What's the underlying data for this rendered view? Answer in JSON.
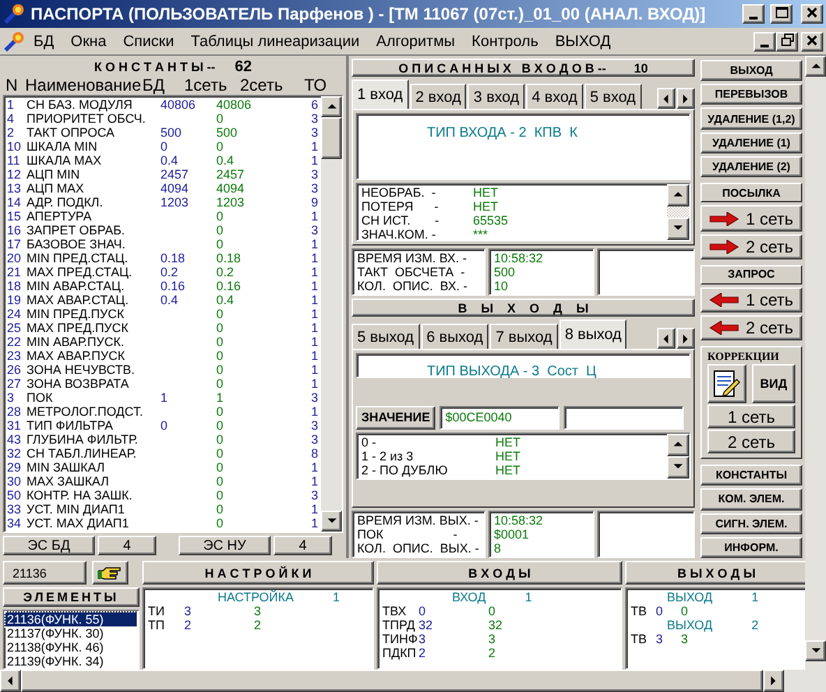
{
  "window": {
    "title": "ПАСПОРТА  (ПОЛЬЗОВАТЕЛЬ Парфенов ) - [ТМ 11067 (07ст.)_01_00 (АНАЛ. ВХОД)]"
  },
  "menu": [
    "БД",
    "Окна",
    "Списки",
    "Таблицы линеаризации",
    "Алгоритмы",
    "Контроль",
    "ВЫХОД"
  ],
  "constants": {
    "title": "К О Н С Т А Н Т Ы --",
    "count": "62",
    "columns": [
      "N",
      "Наименование",
      "БД",
      "1сеть",
      "2сеть",
      "ТО"
    ],
    "rows": [
      {
        "n": "1",
        "name": "СН БАЗ. МОДУЛЯ",
        "bd": "40806",
        "net1": "40806",
        "to": "6"
      },
      {
        "n": "4",
        "name": "ПРИОРИТЕТ ОБСЧ.",
        "net1": "0",
        "to": "3"
      },
      {
        "n": "2",
        "name": "ТАКТ ОПРОСА",
        "bd": "500",
        "net1": "500",
        "to": "3"
      },
      {
        "n": "10",
        "name": "ШКАЛА MIN",
        "bd": "0",
        "net1": "0",
        "to": "1"
      },
      {
        "n": "11",
        "name": "ШКАЛА MAX",
        "bd": "0.4",
        "net1": "0.4",
        "to": "1"
      },
      {
        "n": "12",
        "name": "АЦП MIN",
        "bd": "2457",
        "net1": "2457",
        "to": "3"
      },
      {
        "n": "13",
        "name": "АЦП MAX",
        "bd": "4094",
        "net1": "4094",
        "to": "3"
      },
      {
        "n": "14",
        "name": "АДР. ПОДКЛ.",
        "bd": "1203",
        "net1": "1203",
        "to": "9"
      },
      {
        "n": "15",
        "name": "АПЕРТУРА",
        "net1": "0",
        "to": "1"
      },
      {
        "n": "16",
        "name": "ЗАПРЕТ ОБРАБ.",
        "net1": "0",
        "to": "3"
      },
      {
        "n": "17",
        "name": "БАЗОВОЕ ЗНАЧ.",
        "net1": "0",
        "to": "1"
      },
      {
        "n": "20",
        "name": "MIN ПРЕД.СТАЦ.",
        "bd": "0.18",
        "net1": "0.18",
        "to": "1"
      },
      {
        "n": "21",
        "name": "MAX ПРЕД.СТАЦ.",
        "bd": "0.2",
        "net1": "0.2",
        "to": "1"
      },
      {
        "n": "18",
        "name": "MIN АВАР.СТАЦ.",
        "bd": "0.16",
        "net1": "0.16",
        "to": "1"
      },
      {
        "n": "19",
        "name": "MAX АВАР.СТАЦ.",
        "bd": "0.4",
        "net1": "0.4",
        "to": "1"
      },
      {
        "n": "24",
        "name": "MIN ПРЕД.ПУСК",
        "net1": "0",
        "to": "1"
      },
      {
        "n": "25",
        "name": "MAX ПРЕД.ПУСК",
        "net1": "0",
        "to": "1"
      },
      {
        "n": "22",
        "name": "MIN АВАР.ПУСК.",
        "net1": "0",
        "to": "1"
      },
      {
        "n": "23",
        "name": "MAX АВАР.ПУСК",
        "net1": "0",
        "to": "1"
      },
      {
        "n": "26",
        "name": "ЗОНА НЕЧУВСТВ.",
        "net1": "0",
        "to": "1"
      },
      {
        "n": "27",
        "name": "ЗОНА ВОЗВРАТА",
        "net1": "0",
        "to": "1"
      },
      {
        "n": "3",
        "name": "ПОК",
        "bd": "1",
        "net1": "1",
        "to": "3"
      },
      {
        "n": "28",
        "name": "МЕТРОЛОГ.ПОДСТ.",
        "net1": "0",
        "to": "1"
      },
      {
        "n": "31",
        "name": "ТИП ФИЛЬТРА",
        "bd": "0",
        "net1": "0",
        "to": "3"
      },
      {
        "n": "43",
        "name": "ГЛУБИНА ФИЛЬТР.",
        "net1": "0",
        "to": "3"
      },
      {
        "n": "32",
        "name": "СН ТАБЛ.ЛИНЕАР.",
        "net1": "0",
        "to": "8"
      },
      {
        "n": "29",
        "name": "MIN ЗАШКАЛ",
        "net1": "0",
        "to": "1"
      },
      {
        "n": "30",
        "name": "MAX ЗАШКАЛ",
        "net1": "0",
        "to": "1"
      },
      {
        "n": "50",
        "name": "КОНТР. НА ЗАШК.",
        "net1": "0",
        "to": "3"
      },
      {
        "n": "33",
        "name": "УСТ. MIN ДИАП1",
        "net1": "0",
        "to": "1"
      },
      {
        "n": "34",
        "name": "УСТ. MAX ДИАП1",
        "net1": "0",
        "to": "1"
      }
    ],
    "footer": [
      "ЭС БД",
      "4",
      "ЭС НУ",
      "4"
    ]
  },
  "inputs": {
    "title": "О П И С А Н Н Ы Х   В Х О Д О В --",
    "count": "10",
    "tabs": [
      {
        "label": "1 вход",
        "selected": true
      },
      {
        "label": "2 вход",
        "selected": false
      },
      {
        "label": "3 вход",
        "selected": false
      },
      {
        "label": "4 вход",
        "selected": false
      },
      {
        "label": "5 вход",
        "selected": false
      }
    ],
    "type_line": "ТИП ВХОДА - 2  КПВ  К",
    "params": [
      {
        "label": "НЕОБРАБ.  -",
        "value": "НЕТ"
      },
      {
        "label": "ПОТЕРЯ      -",
        "value": "НЕТ"
      },
      {
        "label": "СН ИСТ.       -",
        "value": "65535"
      },
      {
        "label": "ЗНАЧ.КОМ. -",
        "value": "***"
      }
    ],
    "info": [
      {
        "label": "ВРЕМЯ ИЗМ. ВХ. -",
        "value": "10:58:32"
      },
      {
        "label": "ТАКТ  ОБСЧЕТА  -",
        "value": "500"
      },
      {
        "label": "КОЛ.  ОПИС.  ВХ. -",
        "value": "10"
      }
    ]
  },
  "outputs": {
    "title": "В    Ы    Х    О    Д    Ы",
    "tabs": [
      {
        "label": "5 выход",
        "selected": false
      },
      {
        "label": "6 выход",
        "selected": false
      },
      {
        "label": "7 выход",
        "selected": false
      },
      {
        "label": "8 выход",
        "selected": true
      }
    ],
    "type_line": "ТИП ВЫХОДА - 3  Сост  Ц",
    "value_label": "ЗНАЧЕНИЕ",
    "value": "$00CE0040",
    "params": [
      {
        "label": "0 -",
        "value": "НЕТ"
      },
      {
        "label": "1 - 2 из 3",
        "value": "НЕТ"
      },
      {
        "label": "2 - ПО ДУБЛЮ",
        "value": "НЕТ"
      }
    ],
    "info": [
      {
        "label": "ВРЕМЯ ИЗМ. ВЫХ. -",
        "value": "10:58:32"
      },
      {
        "label": "ПОК                    -",
        "value": "$0001"
      },
      {
        "label": "КОЛ.  ОПИС.  ВЫХ. -",
        "value": "8"
      }
    ]
  },
  "actions": [
    {
      "kind": "button",
      "label": "ВЫХОД"
    },
    {
      "kind": "button",
      "label": "ПЕРЕВЫЗОВ"
    },
    {
      "kind": "button",
      "label": "УДАЛЕНИЕ (1,2)"
    },
    {
      "kind": "button",
      "label": "УДАЛЕНИЕ (1)"
    },
    {
      "kind": "button",
      "label": "УДАЛЕНИЕ (2)"
    },
    {
      "kind": "label",
      "label": "ПОСЫЛКА"
    },
    {
      "kind": "send",
      "label": "1 сеть"
    },
    {
      "kind": "send",
      "label": "2 сеть"
    },
    {
      "kind": "label",
      "label": "ЗАПРОС"
    },
    {
      "kind": "request",
      "label": "1 сеть"
    },
    {
      "kind": "request",
      "label": "2 сеть"
    },
    {
      "kind": "correction",
      "label": "КОРРЕКЦИИ",
      "view": "ВИД",
      "nets": [
        "1 сеть",
        "2 сеть"
      ]
    },
    {
      "kind": "button",
      "label": "КОНСТАНТЫ"
    },
    {
      "kind": "button",
      "label": "КОМ. ЭЛЕМ."
    },
    {
      "kind": "button",
      "label": "СИГН. ЭЛЕМ."
    },
    {
      "kind": "button",
      "label": "ИНФОРМ."
    }
  ],
  "bottom": {
    "element_id": "21136",
    "elements_title": "ЭЛЕМЕНТЫ",
    "elements": [
      {
        "label": "21136(ФУНК. 55)",
        "selected": true
      },
      {
        "label": "21137(ФУНК. 30)",
        "selected": false
      },
      {
        "label": "21138(ФУНК. 46)",
        "selected": false
      },
      {
        "label": "21139(ФУНК. 34)",
        "selected": false
      }
    ],
    "panels": [
      {
        "title": "Н А С Т Р О Й К И",
        "groups": [
          {
            "heading": "НАСТРОЙКА",
            "number": "1",
            "rows": [
              {
                "name": "ТИ",
                "v1": "3",
                "v2": "3"
              },
              {
                "name": "ТП",
                "v1": "2",
                "v2": "2"
              }
            ]
          }
        ]
      },
      {
        "title": "В Х О Д Ы",
        "groups": [
          {
            "heading": "ВХОД",
            "number": "1",
            "rows": [
              {
                "name": "ТВХ",
                "v1": "0",
                "v2": "0"
              },
              {
                "name": "ТПРД",
                "v1": "32",
                "v2": "32"
              },
              {
                "name": "ТИНФ",
                "v1": "3",
                "v2": "3"
              },
              {
                "name": "ПДКП",
                "v1": "2",
                "v2": "2"
              }
            ]
          }
        ]
      },
      {
        "title": "В Ы Х О Д Ы",
        "groups": [
          {
            "heading": "ВЫХОД",
            "number": "1",
            "rows": [
              {
                "name": "ТВ",
                "v1": "0",
                "v2": "0"
              }
            ]
          },
          {
            "heading": "ВЫХОД",
            "number": "2",
            "rows": [
              {
                "name": "ТВ",
                "v1": "3",
                "v2": "3"
              }
            ]
          }
        ]
      }
    ]
  }
}
